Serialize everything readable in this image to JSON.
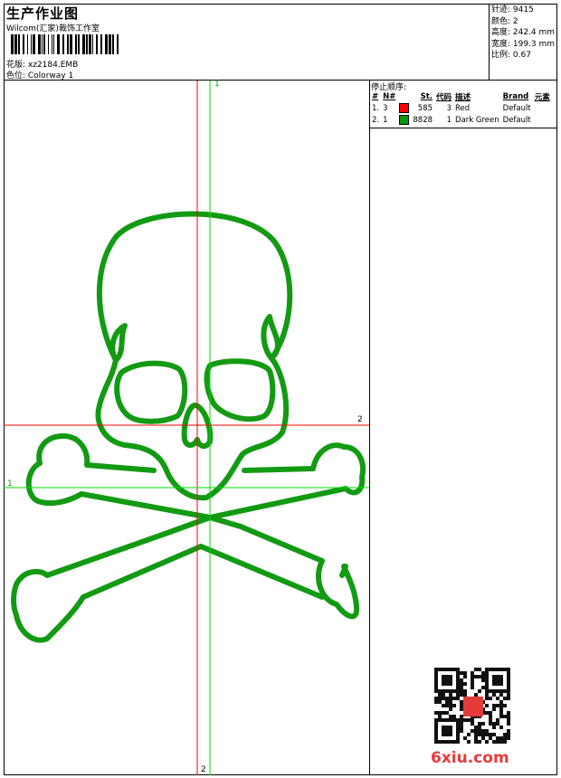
{
  "header": {
    "title": "生产作业图",
    "studio": "Wilcom(汇家)裁饰工作室",
    "design": "花版: xz2184.EMB",
    "colorway": "色位: Colorway 1"
  },
  "stats": {
    "stitches": "针迹: 9415",
    "colors": "颜色: 2",
    "height": "高度: 242.4 mm",
    "width": "宽度: 199.3 mm",
    "scale": "比例: 0.67"
  },
  "stop_sequence": {
    "caption": "停止顺序:",
    "columns": [
      "#",
      "N#",
      "St.",
      "代码",
      "描述",
      "Brand",
      "元素"
    ],
    "rows": [
      {
        "idx": "1.",
        "n": "3",
        "color": "#ff0000",
        "st": "585",
        "code": "3",
        "desc": "Red",
        "brand": "Default"
      },
      {
        "idx": "2.",
        "n": "1",
        "color": "#009900",
        "st": "8828",
        "code": "1",
        "desc": "Dark Green",
        "brand": "Default"
      }
    ]
  },
  "guides": {
    "green_v": "1",
    "red_h": "2",
    "green_h": "1",
    "red_v": "2"
  },
  "colors": {
    "stitch": "#139a13",
    "red_guide": "#ff0000",
    "green_guide": "#00dd00"
  },
  "watermark": "6xiu.com"
}
